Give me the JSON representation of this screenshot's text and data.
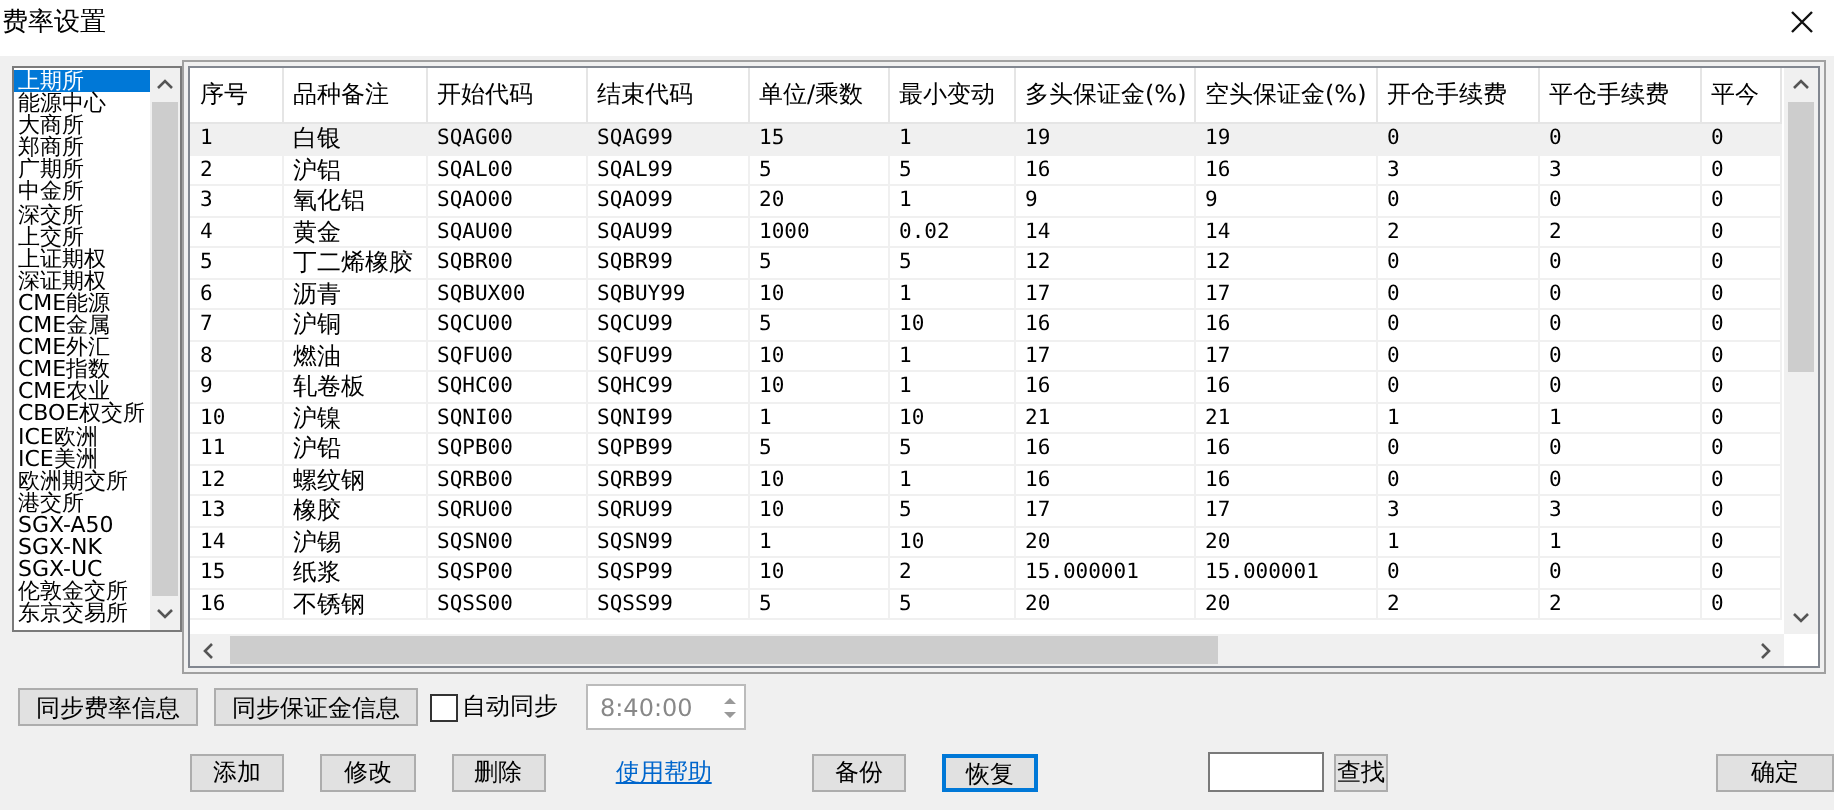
{
  "window": {
    "title": "费率设置"
  },
  "exchanges": [
    {
      "label": "上期所",
      "selected": true
    },
    {
      "label": "能源中心",
      "selected": false
    },
    {
      "label": "大商所",
      "selected": false
    },
    {
      "label": "郑商所",
      "selected": false
    },
    {
      "label": "广期所",
      "selected": false
    },
    {
      "label": "中金所",
      "selected": false
    },
    {
      "label": "深交所",
      "selected": false
    },
    {
      "label": "上交所",
      "selected": false
    },
    {
      "label": "上证期权",
      "selected": false
    },
    {
      "label": "深证期权",
      "selected": false
    },
    {
      "label": "CME能源",
      "selected": false
    },
    {
      "label": "CME金属",
      "selected": false
    },
    {
      "label": "CME外汇",
      "selected": false
    },
    {
      "label": "CME指数",
      "selected": false
    },
    {
      "label": "CME农业",
      "selected": false
    },
    {
      "label": "CBOE权交所",
      "selected": false
    },
    {
      "label": "ICE欧洲",
      "selected": false
    },
    {
      "label": "ICE美洲",
      "selected": false
    },
    {
      "label": "欧洲期交所",
      "selected": false
    },
    {
      "label": "港交所",
      "selected": false
    },
    {
      "label": "SGX-A50",
      "selected": false
    },
    {
      "label": "SGX-NK",
      "selected": false
    },
    {
      "label": "SGX-UC",
      "selected": false
    },
    {
      "label": "伦敦金交所",
      "selected": false
    },
    {
      "label": "东京交易所",
      "selected": false
    }
  ],
  "table": {
    "columns": [
      "序号",
      "品种备注",
      "开始代码",
      "结束代码",
      "单位/乘数",
      "最小变动",
      "多头保证金(%)",
      "空头保证金(%)",
      "开仓手续费",
      "平仓手续费",
      "平今"
    ],
    "rows": [
      {
        "selected": true,
        "cells": [
          "1",
          "白银",
          "SQAG00",
          "SQAG99",
          "15",
          "1",
          "19",
          "19",
          "0",
          "0",
          "0"
        ]
      },
      {
        "selected": false,
        "cells": [
          "2",
          "沪铝",
          "SQAL00",
          "SQAL99",
          "5",
          "5",
          "16",
          "16",
          "3",
          "3",
          "0"
        ]
      },
      {
        "selected": false,
        "cells": [
          "3",
          "氧化铝",
          "SQAO00",
          "SQAO99",
          "20",
          "1",
          "9",
          "9",
          "0",
          "0",
          "0"
        ]
      },
      {
        "selected": false,
        "cells": [
          "4",
          "黄金",
          "SQAU00",
          "SQAU99",
          "1000",
          "0.02",
          "14",
          "14",
          "2",
          "2",
          "0"
        ]
      },
      {
        "selected": false,
        "cells": [
          "5",
          "丁二烯橡胶",
          "SQBR00",
          "SQBR99",
          "5",
          "5",
          "12",
          "12",
          "0",
          "0",
          "0"
        ]
      },
      {
        "selected": false,
        "cells": [
          "6",
          "沥青",
          "SQBUX00",
          "SQBUY99",
          "10",
          "1",
          "17",
          "17",
          "0",
          "0",
          "0"
        ]
      },
      {
        "selected": false,
        "cells": [
          "7",
          "沪铜",
          "SQCU00",
          "SQCU99",
          "5",
          "10",
          "16",
          "16",
          "0",
          "0",
          "0"
        ]
      },
      {
        "selected": false,
        "cells": [
          "8",
          "燃油",
          "SQFU00",
          "SQFU99",
          "10",
          "1",
          "17",
          "17",
          "0",
          "0",
          "0"
        ]
      },
      {
        "selected": false,
        "cells": [
          "9",
          "轧卷板",
          "SQHC00",
          "SQHC99",
          "10",
          "1",
          "16",
          "16",
          "0",
          "0",
          "0"
        ]
      },
      {
        "selected": false,
        "cells": [
          "10",
          "沪镍",
          "SQNI00",
          "SQNI99",
          "1",
          "10",
          "21",
          "21",
          "1",
          "1",
          "0"
        ]
      },
      {
        "selected": false,
        "cells": [
          "11",
          "沪铅",
          "SQPB00",
          "SQPB99",
          "5",
          "5",
          "16",
          "16",
          "0",
          "0",
          "0"
        ]
      },
      {
        "selected": false,
        "cells": [
          "12",
          "螺纹钢",
          "SQRB00",
          "SQRB99",
          "10",
          "1",
          "16",
          "16",
          "0",
          "0",
          "0"
        ]
      },
      {
        "selected": false,
        "cells": [
          "13",
          "橡胶",
          "SQRU00",
          "SQRU99",
          "10",
          "5",
          "17",
          "17",
          "3",
          "3",
          "0"
        ]
      },
      {
        "selected": false,
        "cells": [
          "14",
          "沪锡",
          "SQSN00",
          "SQSN99",
          "1",
          "10",
          "20",
          "20",
          "1",
          "1",
          "0"
        ]
      },
      {
        "selected": false,
        "cells": [
          "15",
          "纸浆",
          "SQSP00",
          "SQSP99",
          "10",
          "2",
          "15.000001",
          "15.000001",
          "0",
          "0",
          "0"
        ]
      },
      {
        "selected": false,
        "cells": [
          "16",
          "不锈钢",
          "SQSS00",
          "SQSS99",
          "5",
          "5",
          "20",
          "20",
          "2",
          "2",
          "0"
        ]
      }
    ]
  },
  "sync_buttons": [
    "同步费率信息",
    "同步保证金信息"
  ],
  "auto_sync": {
    "label": "自动同步",
    "checked": false,
    "time": "8:40:00"
  },
  "actions": [
    {
      "kind": "button",
      "label": "添加",
      "focused": false
    },
    {
      "kind": "button",
      "label": "修改",
      "focused": false
    },
    {
      "kind": "button",
      "label": "删除",
      "focused": false
    },
    {
      "kind": "link",
      "label": "使用帮助",
      "focused": false
    },
    {
      "kind": "button",
      "label": "备份",
      "focused": false
    },
    {
      "kind": "button",
      "label": "恢复",
      "focused": true
    }
  ],
  "search": {
    "button": "查找"
  },
  "ok_button": "确定"
}
